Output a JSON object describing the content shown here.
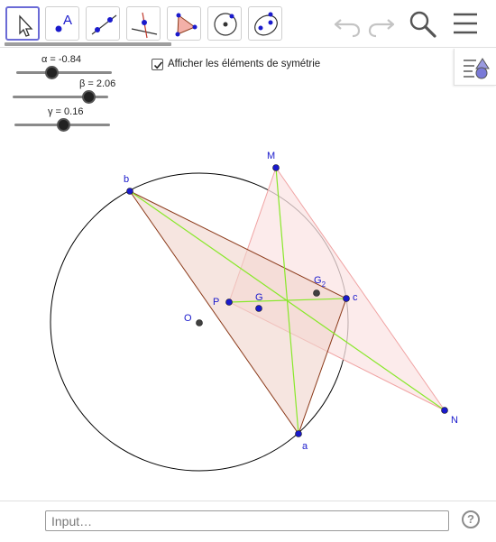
{
  "toolbar": {
    "tools": [
      {
        "name": "move-tool-icon",
        "selected": true
      },
      {
        "name": "point-tool-icon",
        "text": "A"
      },
      {
        "name": "line-tool-icon"
      },
      {
        "name": "perpendicular-line-tool-icon"
      },
      {
        "name": "polygon-tool-icon"
      },
      {
        "name": "circle-center-point-tool-icon"
      },
      {
        "name": "ellipse-tool-icon"
      }
    ],
    "undo_icon": "undo-icon",
    "redo_icon": "redo-icon",
    "search_icon": "search-icon",
    "menu_icon": "hamburger-menu-icon"
  },
  "sliders": [
    {
      "label": "α = -0.84",
      "value": -0.84
    },
    {
      "label": "β = 2.06",
      "value": 2.06
    },
    {
      "label": "γ = 0.16",
      "value": 0.16
    }
  ],
  "checkbox": {
    "label": "Afficher les éléments de symétrie",
    "checked": true
  },
  "geometry": {
    "colors": {
      "point": "#1a1acc",
      "center_point": "#404040",
      "label": "#1a1acc",
      "circle": "#000000",
      "triangle_abc_edge": "#8b3a1a",
      "triangle_abc_fill": "#f0d3cc",
      "triangle_mnp_edge": "#f0a3a3",
      "triangle_mnp_fill": "#fbe4e4",
      "lines": "#88e82a"
    },
    "points": {
      "b": {
        "label": "b"
      },
      "a": {
        "label": "a"
      },
      "c": {
        "label": "c"
      },
      "M": {
        "label": "M"
      },
      "N": {
        "label": "N"
      },
      "P": {
        "label": "P"
      },
      "G": {
        "label": "G"
      },
      "G2": {
        "label": "G",
        "subscript": "2"
      },
      "O": {
        "label": "O"
      }
    }
  },
  "input": {
    "placeholder": "Input…"
  },
  "help": {
    "glyph": "?"
  }
}
